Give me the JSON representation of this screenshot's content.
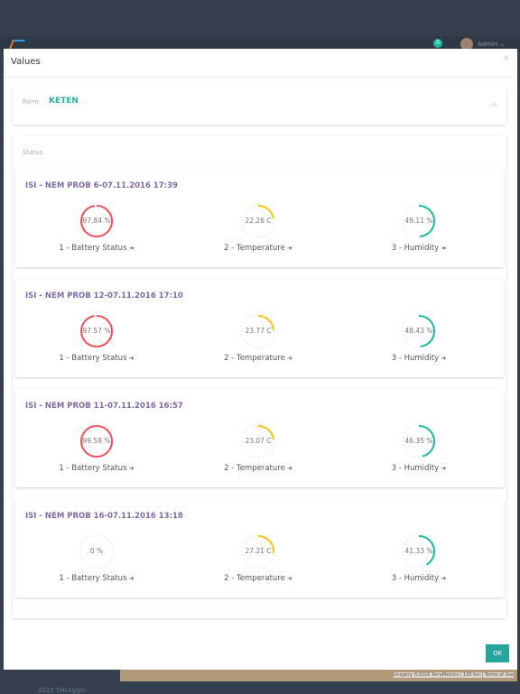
{
  "header": {
    "notification_count": "0",
    "user": "Admin"
  },
  "modal": {
    "title": "Values",
    "close": "×",
    "form_label": "Form:",
    "form_value": "KETEN",
    "status_label": "Status",
    "ok_label": "OK"
  },
  "colors": {
    "battery": "#f0505a",
    "temperature": "#f5c518",
    "humidity": "#1abc9c",
    "title": "#7e6aa8",
    "accent": "#26a69a"
  },
  "cards": [
    {
      "title": "ISI - NEM PROB 6-07.11.2016 17:39",
      "gauges": [
        {
          "label": "1 - Battery Status",
          "value": "97.84 %",
          "fraction": 0.9784
        },
        {
          "label": "2 - Temperature",
          "value": "22.26 C",
          "fraction": 0.2226
        },
        {
          "label": "3 - Humidity",
          "value": "49.11 %",
          "fraction": 0.4911
        }
      ]
    },
    {
      "title": "ISI - NEM PROB 12-07.11.2016 17:10",
      "gauges": [
        {
          "label": "1 - Battery Status",
          "value": "97.57 %",
          "fraction": 0.9757
        },
        {
          "label": "2 - Temperature",
          "value": "23.77 C",
          "fraction": 0.2377
        },
        {
          "label": "3 - Humidity",
          "value": "48.43 %",
          "fraction": 0.4843
        }
      ]
    },
    {
      "title": "ISI - NEM PROB 11-07.11.2016 16:57",
      "gauges": [
        {
          "label": "1 - Battery Status",
          "value": "99.58 %",
          "fraction": 0.9958
        },
        {
          "label": "2 - Temperature",
          "value": "23.07 C",
          "fraction": 0.2307
        },
        {
          "label": "3 - Humidity",
          "value": "46.35 %",
          "fraction": 0.4635
        }
      ]
    },
    {
      "title": "ISI - NEM PROB 16-07.11.2016 13:18",
      "gauges": [
        {
          "label": "1 - Battery Status",
          "value": "0 %",
          "fraction": 0
        },
        {
          "label": "2 - Temperature",
          "value": "27.21 C",
          "fraction": 0.2721
        },
        {
          "label": "3 - Humidity",
          "value": "41.33 %",
          "fraction": 0.4133
        }
      ]
    }
  ],
  "map": {
    "attribution": "Imagery ©2016 TerraMetrics",
    "scale": "100 km",
    "terms": "Terms of Use"
  },
  "footer": {
    "text": "2015 THLogger"
  }
}
